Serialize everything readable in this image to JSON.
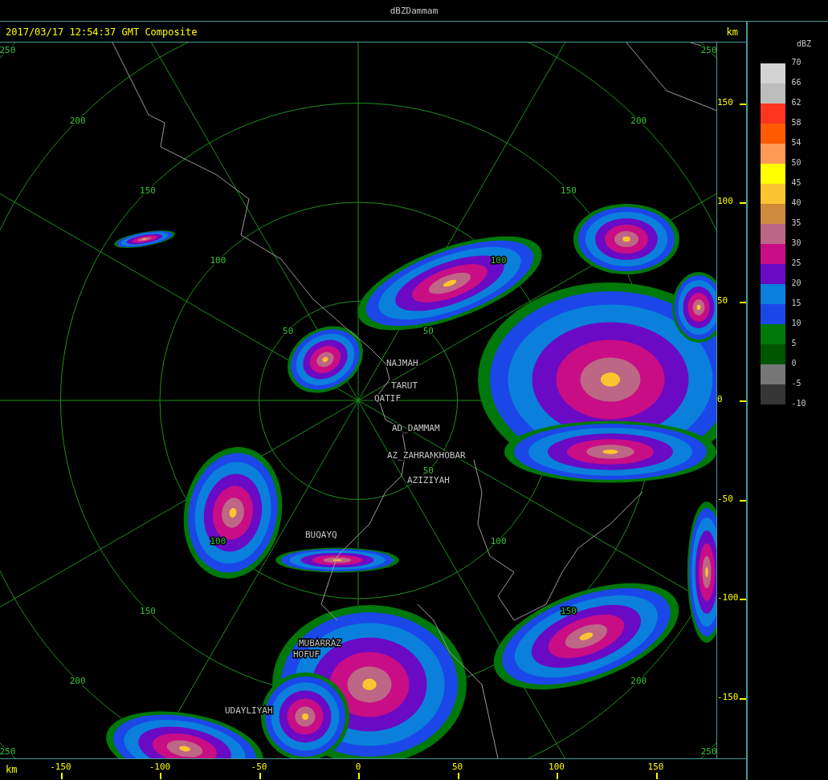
{
  "window": {
    "title": "dBZDammam"
  },
  "header": {
    "timestamp": "2017/03/17 12:54:37 GMT Composite",
    "unit": "km"
  },
  "map": {
    "range_rings": [
      {
        "labels": [
          "50",
          "50",
          "50"
        ]
      },
      {
        "labels": [
          "100",
          "100",
          "100",
          "100"
        ]
      },
      {
        "labels": [
          "150",
          "150",
          "150",
          "150"
        ]
      },
      {
        "labels": [
          "200",
          "200",
          "200",
          "200"
        ]
      },
      {
        "labels": [
          "250",
          "250",
          "250",
          "250"
        ]
      }
    ],
    "cities": [
      "NAJMAH",
      "TARUT",
      "QATIF",
      "AD_DAMMAM",
      "AZ_ZAHRAN",
      "KHOBAR",
      "AZIZIYAH",
      "BUQAYQ",
      "MUBARRAZ",
      "HOFUF",
      "UDAYLIYAH"
    ]
  },
  "y_axis": {
    "ticks": [
      "150",
      "100",
      "50",
      "0",
      "-50",
      "-100",
      "-150"
    ]
  },
  "x_axis": {
    "unit": "km",
    "ticks": [
      "-150",
      "-100",
      "-50",
      "0",
      "50",
      "100",
      "150"
    ]
  },
  "legend": {
    "title": "dBZ",
    "bins": [
      {
        "color": "#d3d3d3"
      },
      {
        "color": "#bdbdbd"
      },
      {
        "color": "#ff3520"
      },
      {
        "color": "#ff5a00"
      },
      {
        "color": "#ff9a55"
      },
      {
        "color": "#ffff00"
      },
      {
        "color": "#fbc531"
      },
      {
        "color": "#cf8a3e"
      },
      {
        "color": "#bd6686"
      },
      {
        "color": "#c90d85"
      },
      {
        "color": "#6a0ac5"
      },
      {
        "color": "#0a80dc"
      },
      {
        "color": "#1c47e8"
      },
      {
        "color": "#00780a"
      },
      {
        "color": "#005500"
      },
      {
        "color": "#767676"
      },
      {
        "color": "#363636"
      }
    ],
    "ticks": [
      "70",
      "66",
      "62",
      "58",
      "54",
      "50",
      "45",
      "40",
      "35",
      "30",
      "25",
      "20",
      "15",
      "10",
      "5",
      "0",
      "-5",
      "-10"
    ]
  }
}
